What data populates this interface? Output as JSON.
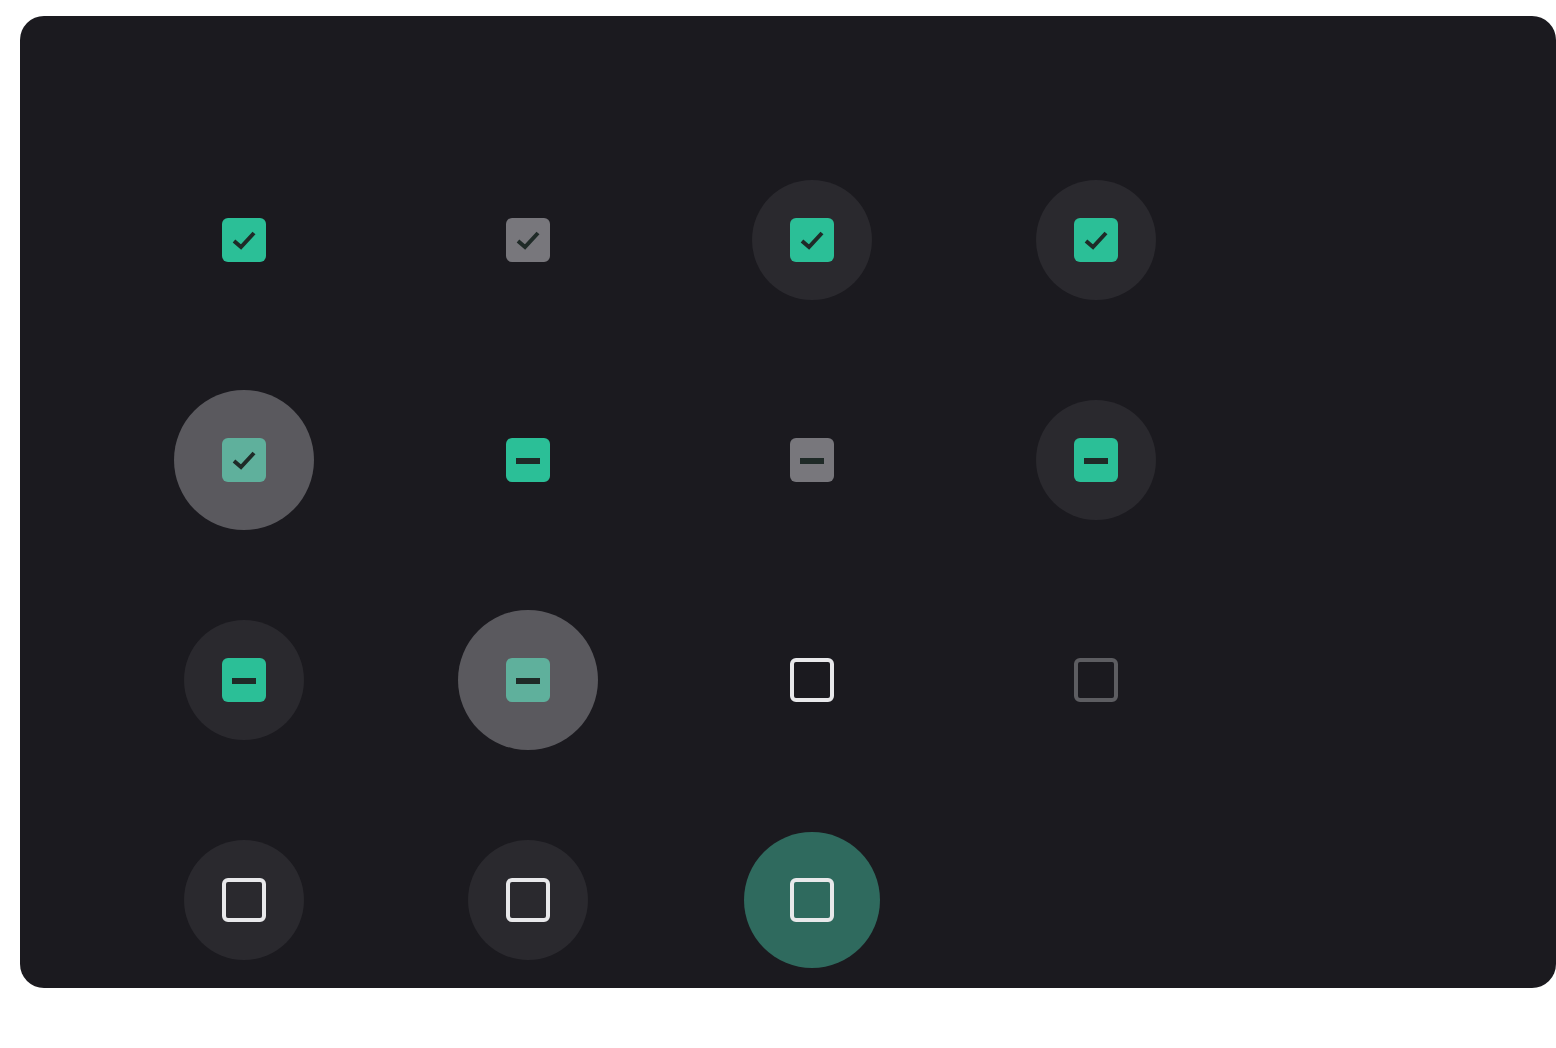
{
  "checkboxes": [
    {
      "kind": "checked",
      "disabled": false,
      "hovered": false,
      "pressed": false,
      "focused": false
    },
    {
      "kind": "checked",
      "disabled": true,
      "hovered": false,
      "pressed": false,
      "focused": false
    },
    {
      "kind": "checked",
      "disabled": false,
      "hovered": true,
      "pressed": false,
      "focused": false
    },
    {
      "kind": "checked",
      "disabled": false,
      "hovered": true,
      "pressed": false,
      "focused": false
    },
    {
      "kind": "checked",
      "disabled": false,
      "hovered": false,
      "pressed": true,
      "focused": false
    },
    {
      "kind": "indeterminate",
      "disabled": false,
      "hovered": false,
      "pressed": false,
      "focused": false
    },
    {
      "kind": "indeterminate",
      "disabled": true,
      "hovered": false,
      "pressed": false,
      "focused": false
    },
    {
      "kind": "indeterminate",
      "disabled": false,
      "hovered": true,
      "pressed": false,
      "focused": false
    },
    {
      "kind": "indeterminate",
      "disabled": false,
      "hovered": true,
      "pressed": false,
      "focused": false
    },
    {
      "kind": "indeterminate",
      "disabled": false,
      "hovered": false,
      "pressed": true,
      "focused": false
    },
    {
      "kind": "unchecked",
      "disabled": false,
      "hovered": false,
      "pressed": false,
      "focused": false
    },
    {
      "kind": "unchecked",
      "disabled": true,
      "hovered": false,
      "pressed": false,
      "focused": false
    },
    {
      "kind": "unchecked",
      "disabled": false,
      "hovered": true,
      "pressed": false,
      "focused": false
    },
    {
      "kind": "unchecked",
      "disabled": false,
      "hovered": true,
      "pressed": false,
      "focused": false
    },
    {
      "kind": "unchecked",
      "disabled": false,
      "hovered": false,
      "pressed": false,
      "focused": true
    }
  ]
}
